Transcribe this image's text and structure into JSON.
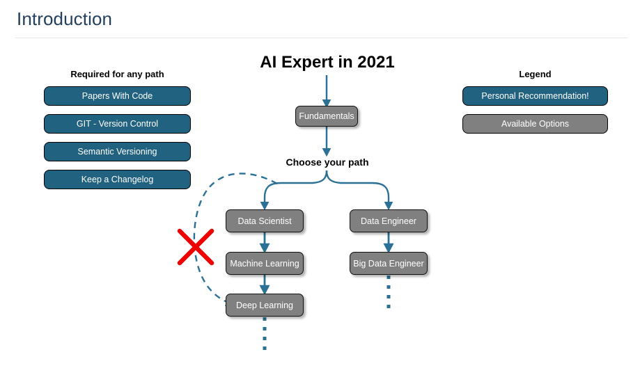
{
  "header": {
    "title": "Introduction"
  },
  "colors": {
    "header_text": "#24405c",
    "recommendation_blue": "#216281",
    "available_gray": "#808080",
    "connector_blue": "#2b7095",
    "cross_out_red": "#ee0000",
    "node_text": "#ffffff",
    "background": "#ffffff"
  },
  "required_panel": {
    "heading": "Required for any path",
    "items": [
      {
        "label": "Papers With Code",
        "style": "blue"
      },
      {
        "label": "GIT - Version Control",
        "style": "blue"
      },
      {
        "label": "Semantic Versioning",
        "style": "blue"
      },
      {
        "label": "Keep a Changelog",
        "style": "blue"
      }
    ]
  },
  "legend_panel": {
    "heading": "Legend",
    "items": [
      {
        "label": "Personal Recommendation!",
        "style": "blue"
      },
      {
        "label": "Available Options",
        "style": "gray"
      }
    ]
  },
  "flow": {
    "title": "AI Expert in 2021",
    "choose_label": "Choose your path",
    "nodes": {
      "fundamentals": "Fundamentals",
      "data_scientist": "Data Scientist",
      "machine_learning": "Machine Learning",
      "deep_learning": "Deep Learning",
      "data_engineer": "Data Engineer",
      "big_data_engineer": "Big Data Engineer"
    },
    "annotations": {
      "shortcut_crossed_out": "X"
    }
  }
}
